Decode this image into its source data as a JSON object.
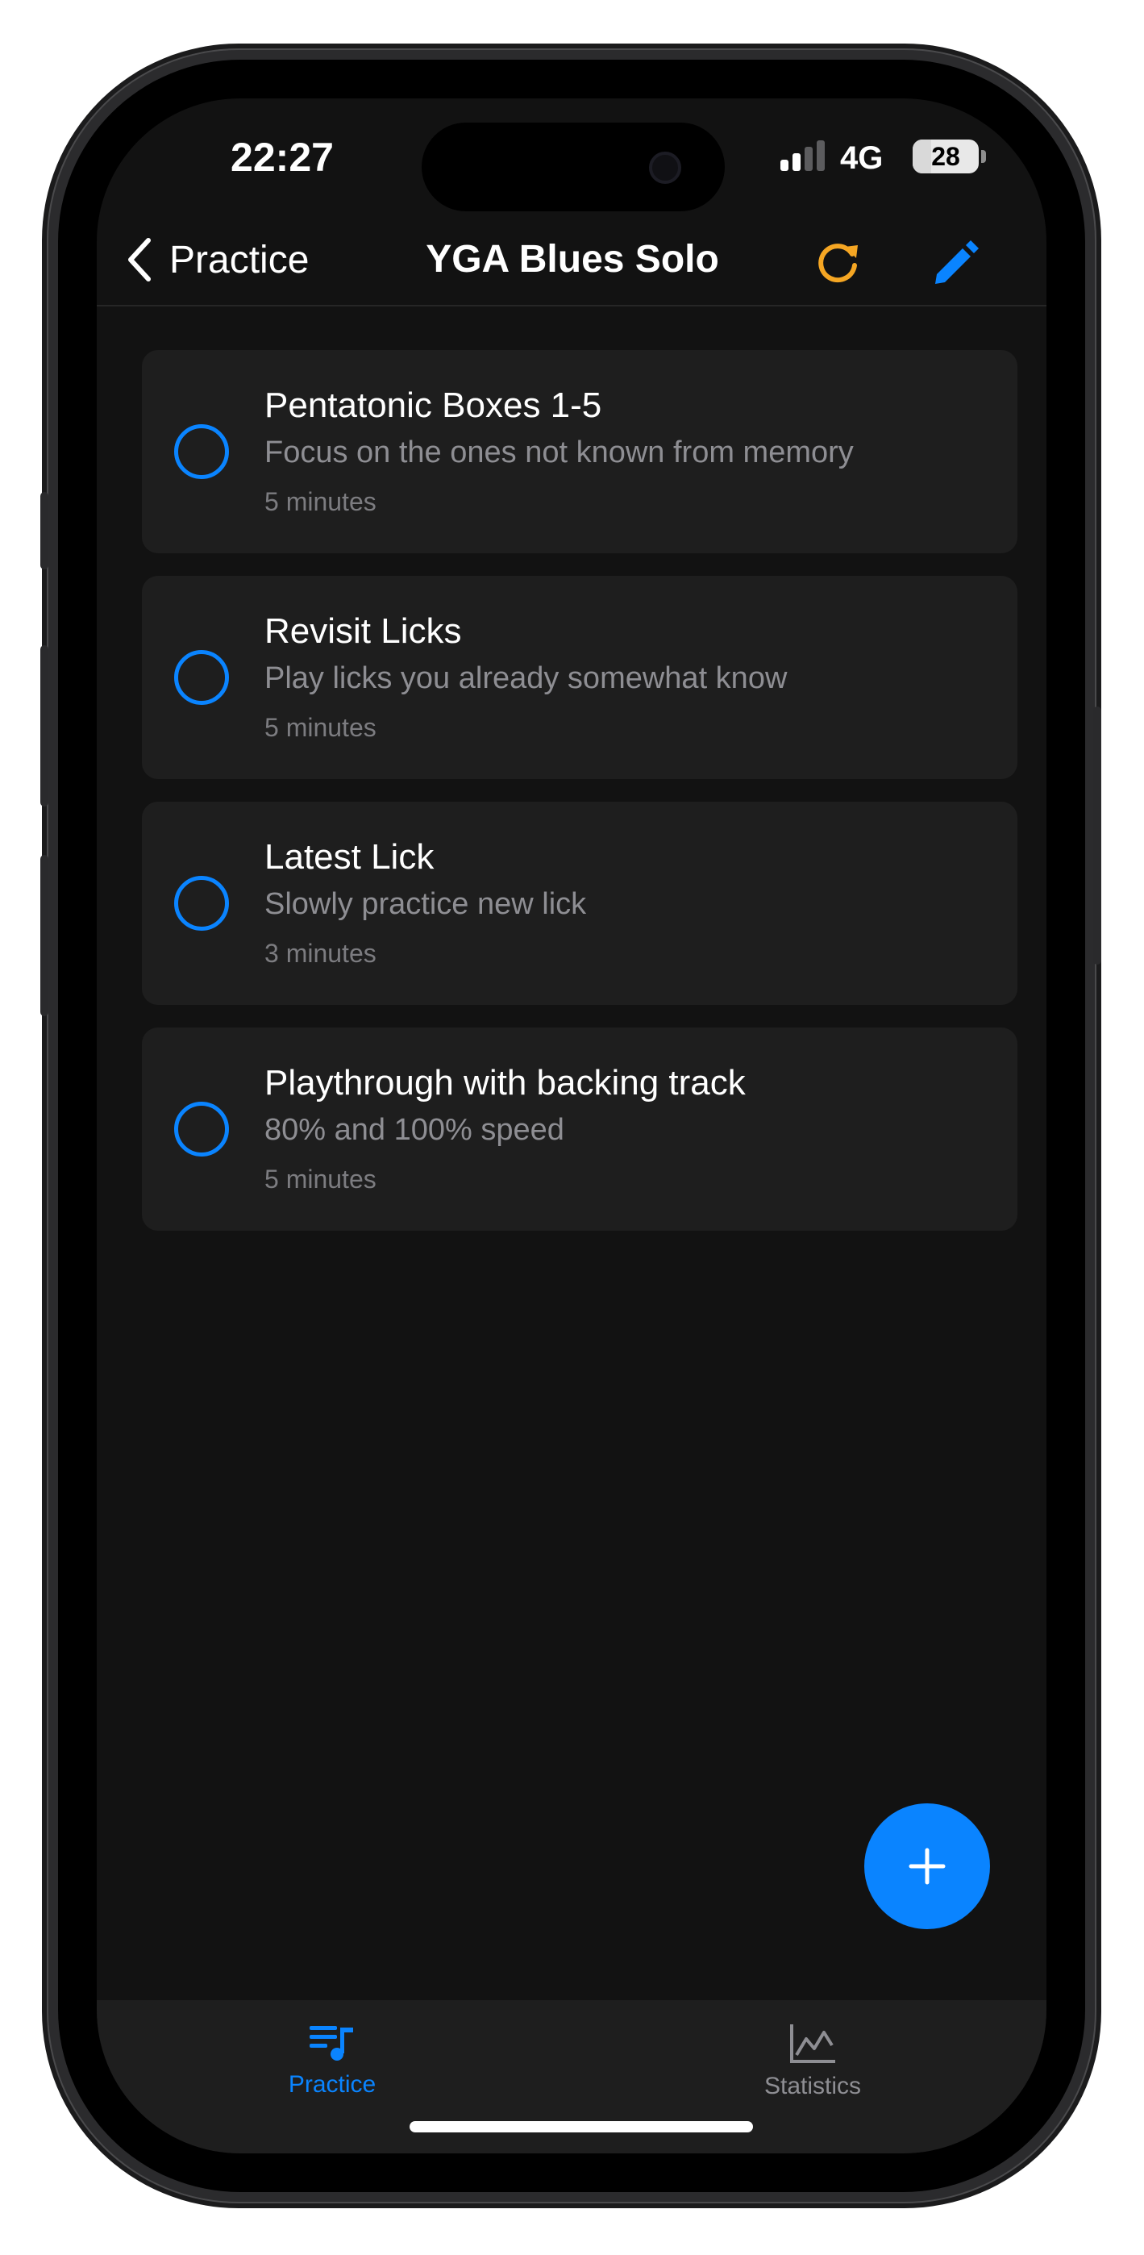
{
  "status_bar": {
    "time": "22:27",
    "network": "4G",
    "battery_level": "28"
  },
  "nav": {
    "back_label": "Practice",
    "title": "YGA Blues Solo",
    "refresh_icon": "refresh-icon",
    "edit_icon": "pencil-icon"
  },
  "items": [
    {
      "title": "Pentatonic Boxes 1-5",
      "description": "Focus on the ones not known from memory",
      "duration": "5 minutes"
    },
    {
      "title": "Revisit Licks",
      "description": "Play licks you already somewhat know",
      "duration": "5 minutes"
    },
    {
      "title": "Latest Lick",
      "description": "Slowly practice new lick",
      "duration": "3 minutes"
    },
    {
      "title": "Playthrough with backing track",
      "description": "80% and 100% speed",
      "duration": "5 minutes"
    }
  ],
  "fab": {
    "icon": "plus-icon"
  },
  "tabs": [
    {
      "label": "Practice",
      "icon": "music-list-icon",
      "active": true
    },
    {
      "label": "Statistics",
      "icon": "line-chart-icon",
      "active": false
    }
  ],
  "colors": {
    "accent": "#0A84FF",
    "refresh": "#F5A623",
    "background": "#121212",
    "card": "#1E1E1E",
    "inactive_tab": "#8E8E93"
  }
}
